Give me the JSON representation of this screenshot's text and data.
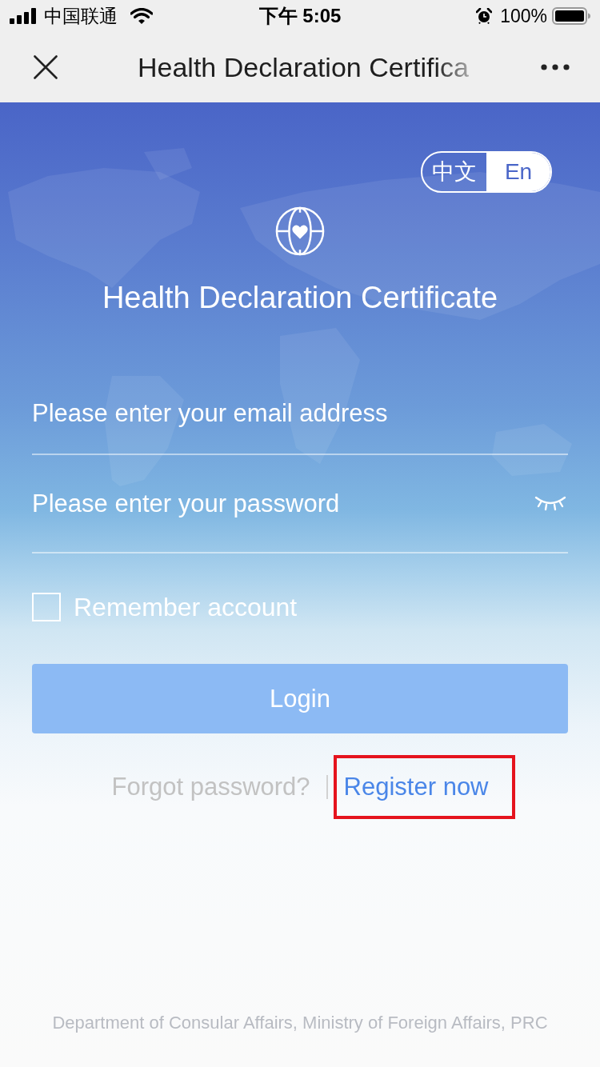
{
  "status_bar": {
    "carrier": "中国联通",
    "time": "下午 5:05",
    "battery": "100%"
  },
  "nav_bar": {
    "title": "Health Declaration Certifica"
  },
  "language_toggle": [
    {
      "label": "中文",
      "selected": false
    },
    {
      "label": "En",
      "selected": true
    }
  ],
  "app_title": "Health Declaration Certificate",
  "form": {
    "email": {
      "placeholder": "Please enter your email address"
    },
    "password": {
      "placeholder": "Please enter your password"
    },
    "remember": {
      "label": "Remember account",
      "checked": false
    },
    "login_button": "Login"
  },
  "links": {
    "forgot": "Forgot password?",
    "register": {
      "label": "Register now",
      "highlighted": true
    }
  },
  "footer": "Department of Consular Affairs, Ministry of Foreign Affairs, PRC"
}
